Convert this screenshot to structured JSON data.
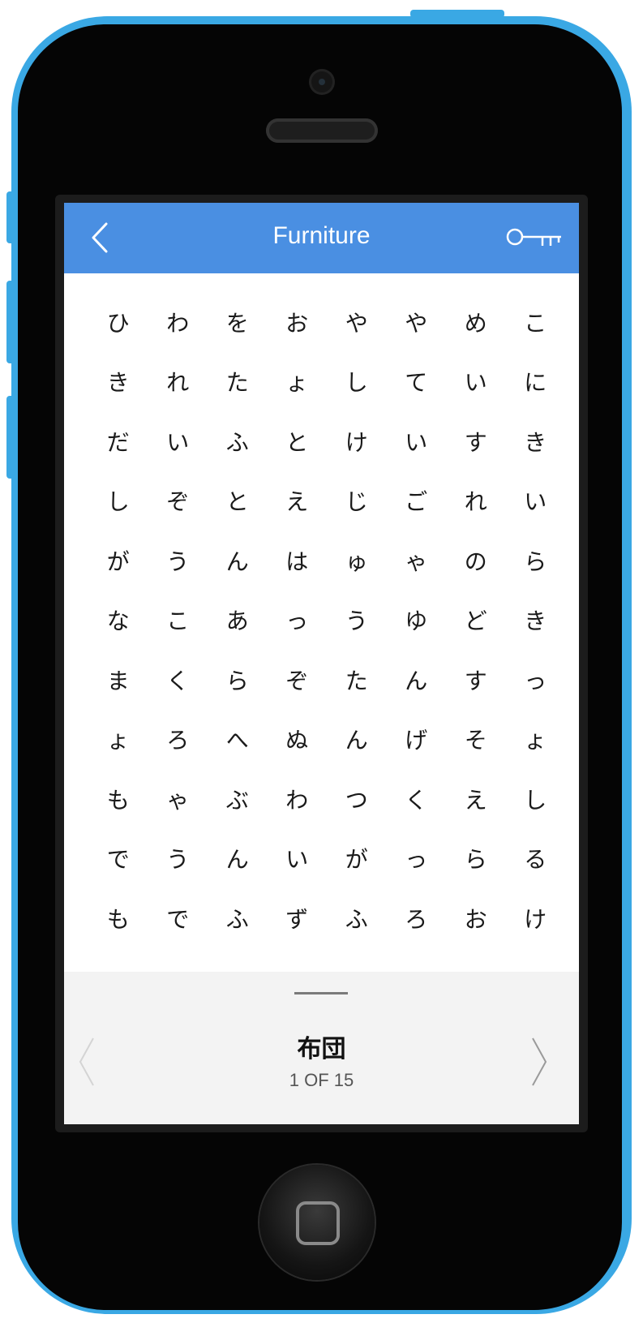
{
  "header": {
    "title": "Furniture",
    "back_icon": "chevron-left-icon",
    "key_icon": "key-icon"
  },
  "colors": {
    "nav_bar": "#4a8fe2",
    "phone_body": "#3aa8e4",
    "panel": "#f3f3f3"
  },
  "grid": {
    "rows": [
      [
        "ひ",
        "わ",
        "を",
        "お",
        "や",
        "や",
        "め",
        "こ"
      ],
      [
        "き",
        "れ",
        "た",
        "ょ",
        "し",
        "て",
        "い",
        "に"
      ],
      [
        "だ",
        "い",
        "ふ",
        "と",
        "け",
        "い",
        "す",
        "き"
      ],
      [
        "し",
        "ぞ",
        "と",
        "え",
        "じ",
        "ご",
        "れ",
        "い"
      ],
      [
        "が",
        "う",
        "ん",
        "は",
        "ゅ",
        "ゃ",
        "の",
        "ら"
      ],
      [
        "な",
        "こ",
        "あ",
        "っ",
        "う",
        "ゆ",
        "ど",
        "き"
      ],
      [
        "ま",
        "く",
        "ら",
        "ぞ",
        "た",
        "ん",
        "す",
        "っ"
      ],
      [
        "ょ",
        "ろ",
        "へ",
        "ぬ",
        "ん",
        "げ",
        "そ",
        "ょ"
      ],
      [
        "も",
        "ゃ",
        "ぶ",
        "わ",
        "つ",
        "く",
        "え",
        "し"
      ],
      [
        "で",
        "う",
        "ん",
        "い",
        "が",
        "っ",
        "ら",
        "る"
      ],
      [
        "も",
        "で",
        "ふ",
        "ず",
        "ふ",
        "ろ",
        "お",
        "け"
      ]
    ]
  },
  "footer": {
    "word": "布団",
    "counter": "1 OF 15",
    "prev_icon": "chevron-left-icon",
    "next_icon": "chevron-right-icon"
  }
}
